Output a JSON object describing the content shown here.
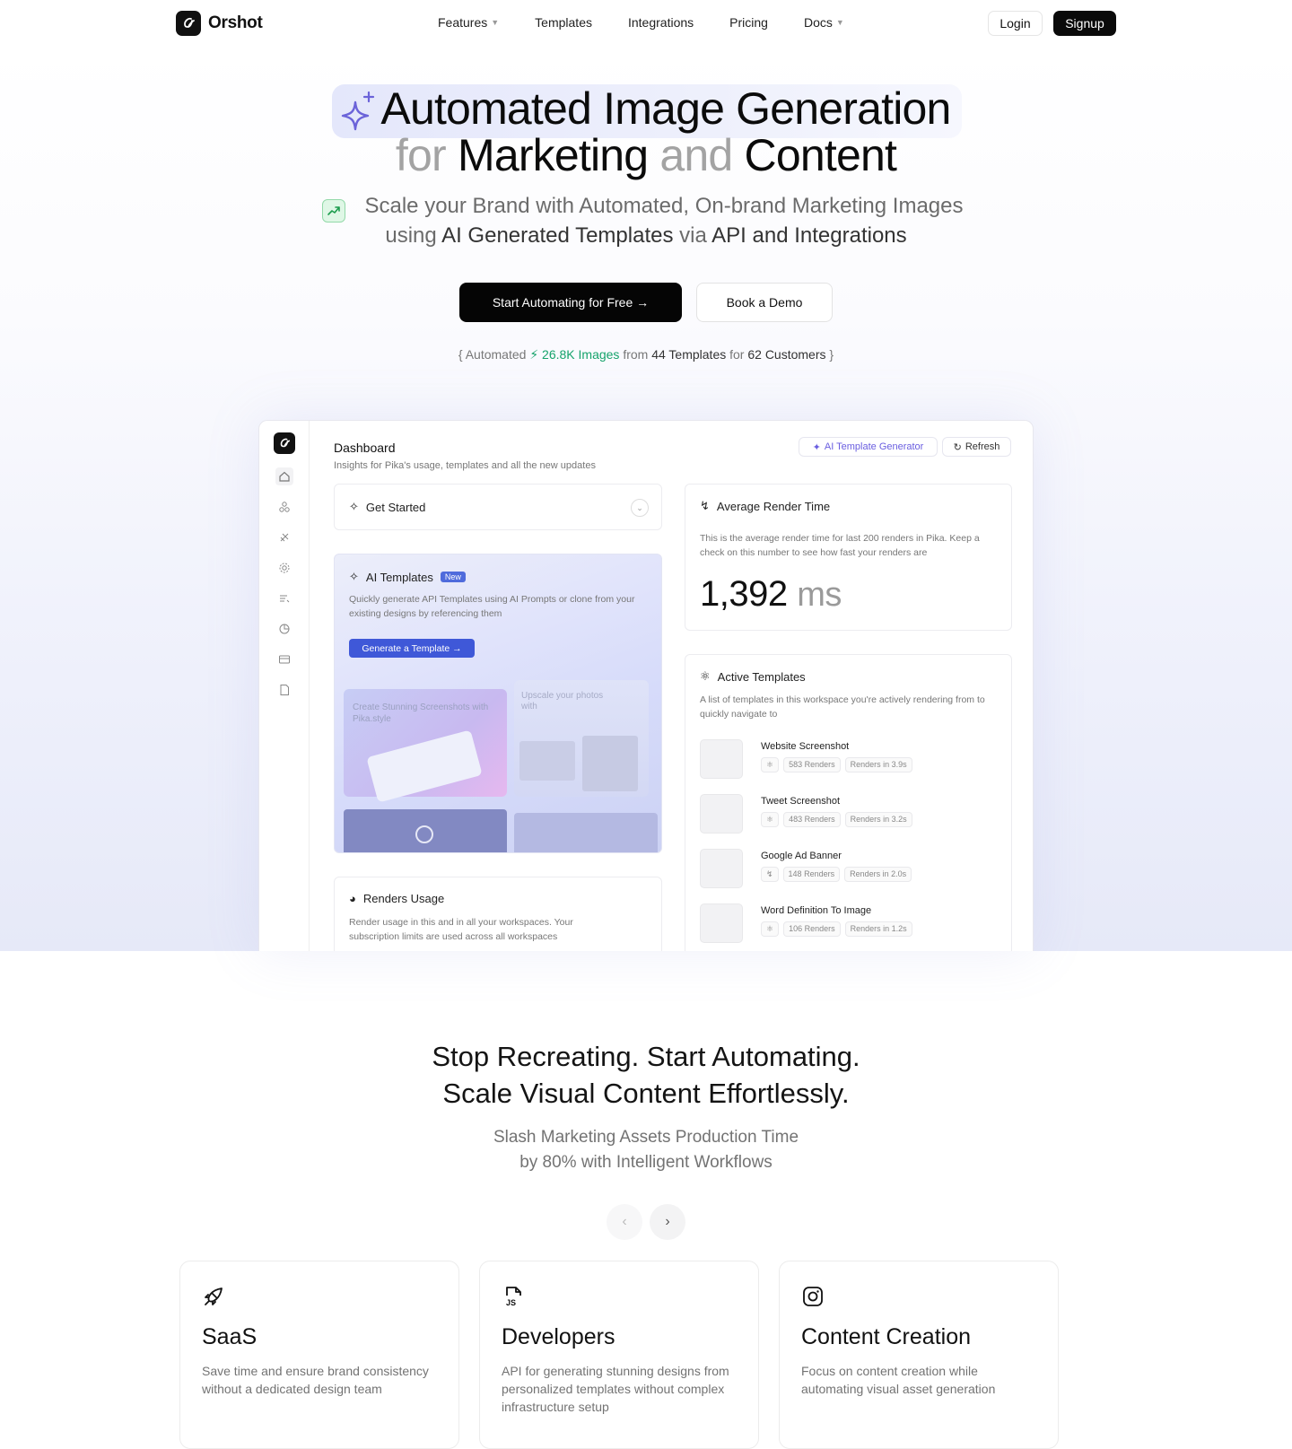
{
  "nav": {
    "brand": "Orshot",
    "items": [
      "Features",
      "Templates",
      "Integrations",
      "Pricing",
      "Docs"
    ],
    "login": "Login",
    "signup": "Signup"
  },
  "hero": {
    "line1": "Automated Image Generation",
    "line2_for": "for",
    "line2_marketing": "Marketing",
    "line2_and": "and",
    "line2_content": "Content",
    "sub_line1": "Scale your Brand with Automated, On-brand Marketing Images",
    "sub_using": "using",
    "sub_ai": "AI Generated Templates",
    "sub_via": "via",
    "sub_api": "API and Integrations",
    "cta_primary": "Start Automating for Free →",
    "cta_secondary": "Book a Demo",
    "stats": {
      "open": "{ Automated",
      "images": "26.8K Images",
      "from": "from",
      "templates": "44 Templates",
      "for": "for",
      "customers": "62 Customers",
      "close": "}"
    }
  },
  "dashboard": {
    "title": "Dashboard",
    "subtitle": "Insights for Pika's usage, templates and all the new updates",
    "ai_generator_btn": "AI Template Generator",
    "refresh_btn": "Refresh",
    "get_started": "Get Started",
    "ai_templates": {
      "title": "AI Templates",
      "badge": "New",
      "desc": "Quickly generate API Templates using AI Prompts or clone from your existing designs by referencing them",
      "button": "Generate a Template →",
      "preview1": "Create Stunning Screenshots with Pika.style",
      "preview2": "Upscale your photos with"
    },
    "renders_usage": {
      "title": "Renders Usage",
      "desc": "Render usage in this and in all your workspaces. Your subscription limits are used across all workspaces"
    },
    "avg_render": {
      "title": "Average Render Time",
      "desc": "This is the average render time for last 200 renders in Pika. Keep a check on this number to see how fast your renders are",
      "value": "1,392",
      "unit": "ms"
    },
    "active_templates": {
      "title": "Active Templates",
      "desc": "A list of templates in this workspace you're actively rendering from to quickly navigate to",
      "items": [
        {
          "name": "Website Screenshot",
          "renders": "583 Renders",
          "time": "Renders in 3.9s"
        },
        {
          "name": "Tweet Screenshot",
          "renders": "483 Renders",
          "time": "Renders in 3.2s"
        },
        {
          "name": "Google Ad Banner",
          "renders": "148 Renders",
          "time": "Renders in 2.0s"
        },
        {
          "name": "Word Definition To Image",
          "renders": "106 Renders",
          "time": "Renders in 1.2s"
        }
      ]
    }
  },
  "section2": {
    "heading1": "Stop Recreating. Start Automating.",
    "heading2": "Scale Visual Content Effortlessly.",
    "sub1": "Slash Marketing Assets Production Time",
    "sub2": "by 80% with Intelligent Workflows",
    "cards": [
      {
        "icon": "rocket-icon",
        "title": "SaaS",
        "desc": "Save time and ensure brand consistency without a dedicated design team"
      },
      {
        "icon": "js-file-icon",
        "title": "Developers",
        "desc": "API for generating stunning designs from personalized templates without complex infrastructure setup"
      },
      {
        "icon": "instagram-icon",
        "title": "Content Creation",
        "desc": "Focus on content creation while automating visual asset generation"
      }
    ]
  },
  "colors": {
    "accent": "#3f58d8",
    "green": "#16a36b",
    "dark": "#0a0a0a"
  }
}
